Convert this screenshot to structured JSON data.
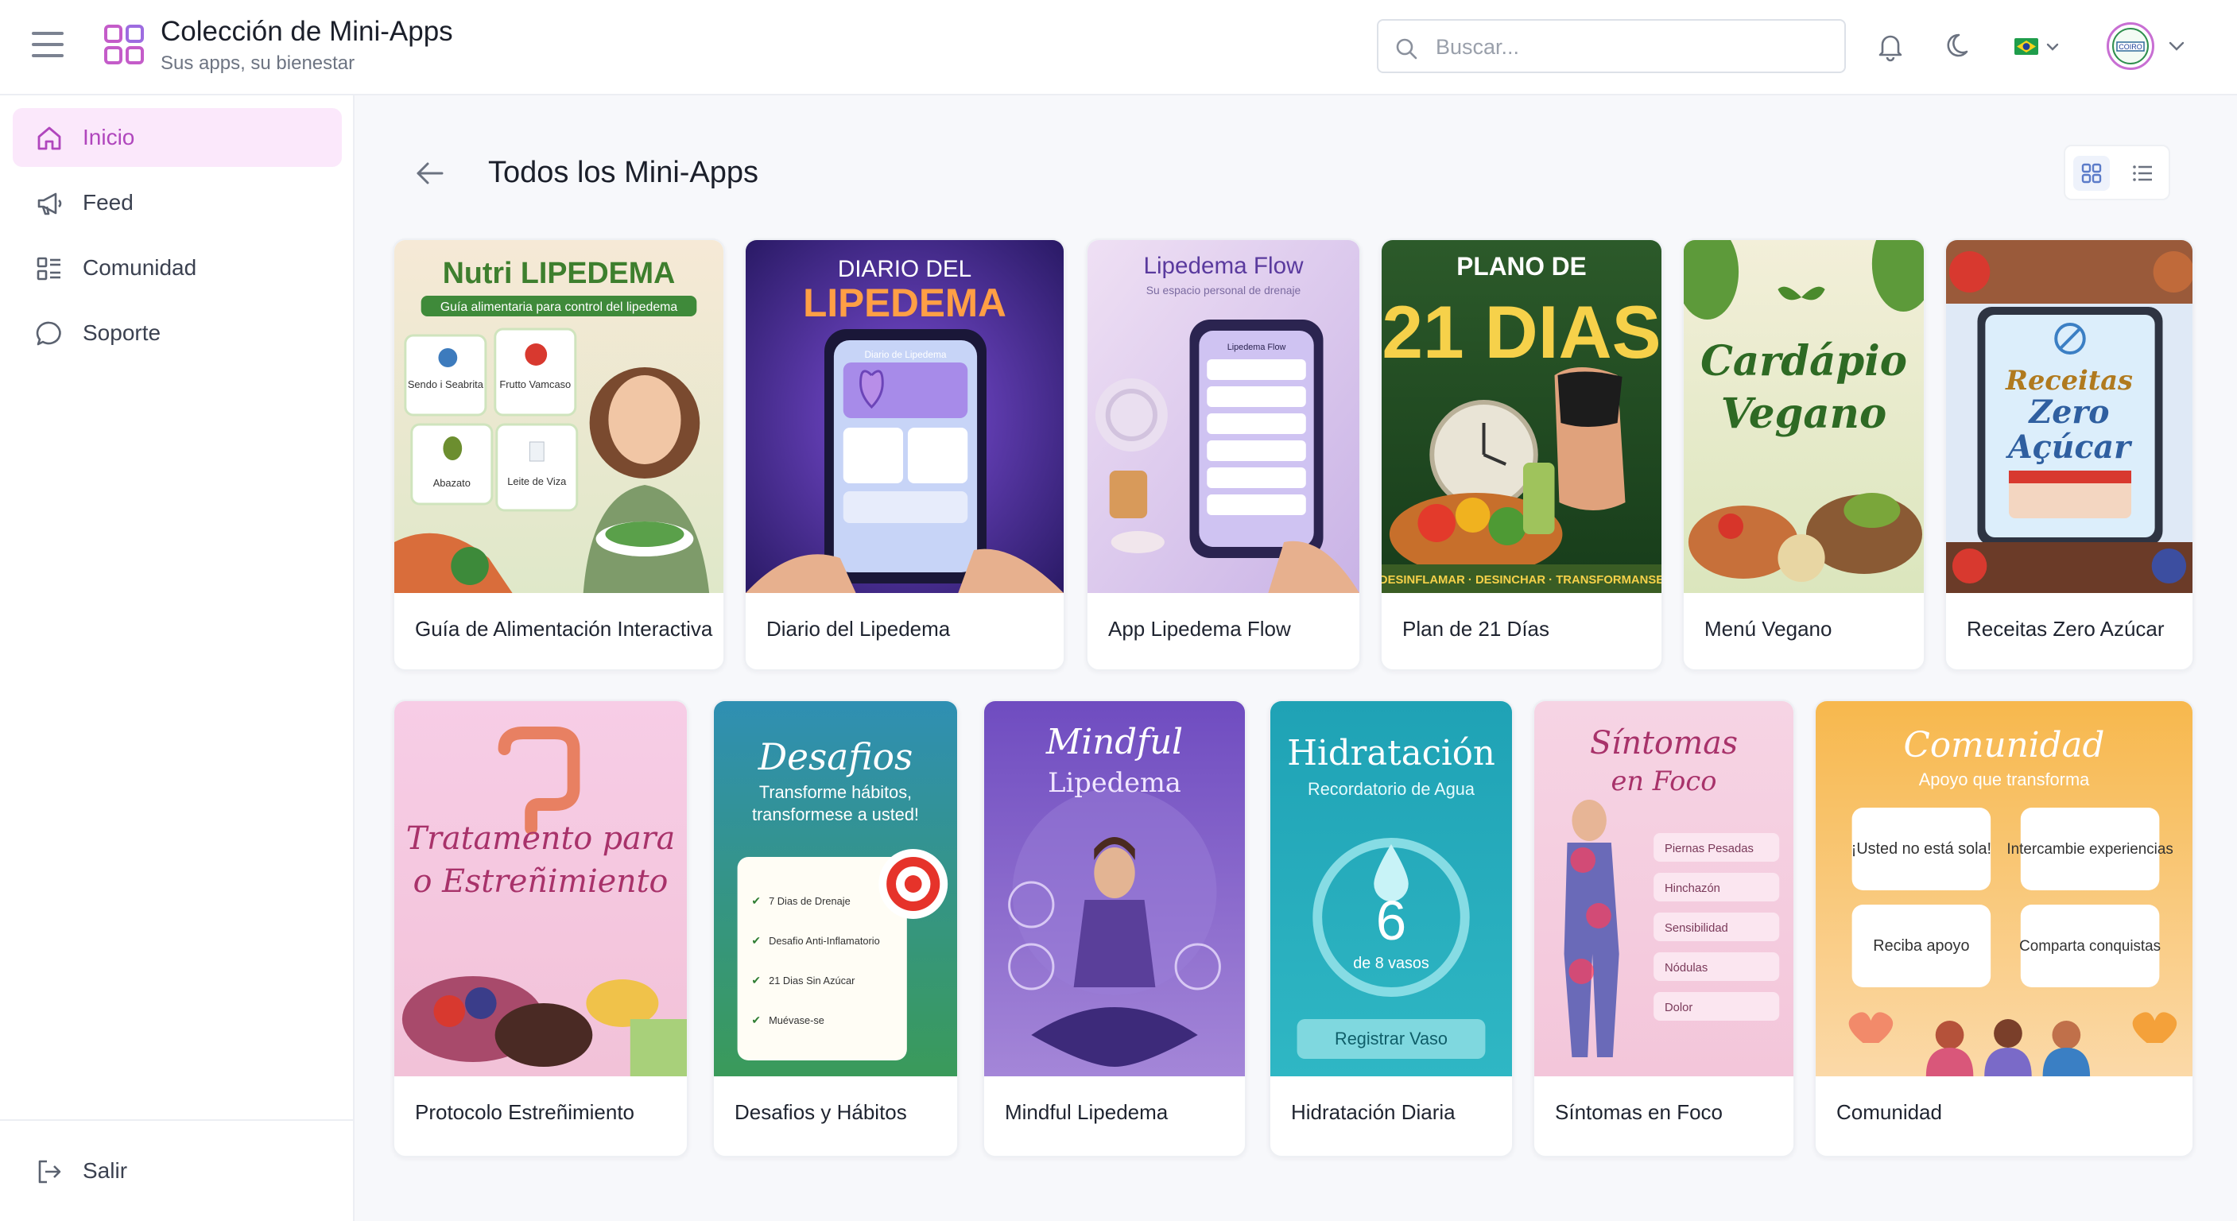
{
  "header": {
    "title": "Colección de Mini-Apps",
    "subtitle": "Sus apps, su bienestar",
    "search_placeholder": "Buscar...",
    "avatar_text": "COIRO"
  },
  "sidebar": {
    "items": [
      {
        "label": "Inicio",
        "icon": "home-icon",
        "active": true
      },
      {
        "label": "Feed",
        "icon": "megaphone-icon",
        "active": false
      },
      {
        "label": "Comunidad",
        "icon": "list-grid-icon",
        "active": false
      },
      {
        "label": "Soporte",
        "icon": "chat-bubble-icon",
        "active": false
      }
    ],
    "logout_label": "Salir"
  },
  "main": {
    "title": "Todos los Mini-Apps",
    "view_mode": "grid"
  },
  "apps": [
    {
      "label": "Guía de Alimentación Interactiva",
      "cover": {
        "title": "Nutri LIPEDEMA",
        "subtitle": "Guía alimentaria para control del lipedema",
        "items": [
          "Sendo i Seabrita",
          "Frutto Vamcaso",
          "Abazato",
          "Leite de Viza"
        ]
      }
    },
    {
      "label": "Diario del Lipedema",
      "cover": {
        "line1": "DIARIO DEL",
        "line2": "LIPEDEMA",
        "screen": "Diario de Lipedema"
      }
    },
    {
      "label": "App Lipedema Flow",
      "cover": {
        "title": "Lipedema Flow",
        "subtitle": "Su espacio personal de drenaje",
        "screen": "Lipedema Flow"
      }
    },
    {
      "label": "Plan de 21 Días",
      "cover": {
        "line1": "PLANO DE",
        "line2": "21 DIAS",
        "footer": "DESINFLAMAR · DESINCHAR · TRANSFORMANSE"
      }
    },
    {
      "label": "Menú Vegano",
      "cover": {
        "line1": "Cardápio",
        "line2": "Vegano"
      }
    },
    {
      "label": "Receitas Zero Azúcar",
      "cover": {
        "line1": "Receitas",
        "line2": "Zero",
        "line3": "Açúcar"
      }
    },
    {
      "label": "Protocolo Estreñimiento",
      "cover": {
        "line1": "Tratamento para",
        "line2": "o Estreñimiento"
      }
    },
    {
      "label": "Desafios y Hábitos",
      "cover": {
        "title": "Desafios",
        "subtitle1": "Transforme hábitos,",
        "subtitle2": "transformese a usted!",
        "checklist": [
          "7 Dias de Drenaje",
          "Desafio Anti-Inflamatorio",
          "21 Dias Sin Azúcar",
          "Muévase-se"
        ]
      }
    },
    {
      "label": "Mindful Lipedema",
      "cover": {
        "line1": "Mindful",
        "line2": "Lipedema"
      }
    },
    {
      "label": "Hidratación Diaria",
      "cover": {
        "title": "Hidratación",
        "subtitle": "Recordatorio de Agua",
        "count": "6",
        "count_caption": "de 8 vasos",
        "button": "Registrar Vaso"
      }
    },
    {
      "label": "Síntomas en Foco",
      "cover": {
        "line1": "Síntomas",
        "line2": "en Foco",
        "symptoms": [
          "Piernas Pesadas",
          "Hinchazón",
          "Sensibilidad",
          "Nódulas",
          "Dolor"
        ]
      }
    },
    {
      "label": "Comunidad",
      "cover": {
        "title": "Comunidad",
        "subtitle": "Apoyo que transforma",
        "bubbles": [
          "¡Usted no está sola!",
          "Intercambie experiencias",
          "Reciba apoyo",
          "Comparta conquistas"
        ]
      }
    }
  ],
  "colors": {
    "accent": "#b046bd",
    "active_bg": "#fbe8fb",
    "page_bg": "#f7f8fb"
  }
}
